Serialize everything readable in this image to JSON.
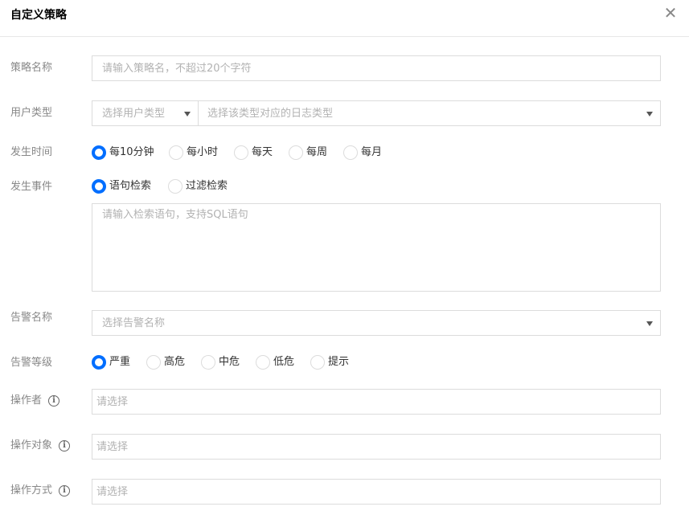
{
  "dialog": {
    "title": "自定义策略"
  },
  "icons": {
    "close": "close-icon",
    "info": "info-icon",
    "dropdown": "caret-down-icon"
  },
  "colors": {
    "accent": "#006eff"
  },
  "fields": {
    "policy_name": {
      "label": "策略名称",
      "placeholder": "请输入策略名，不超过20个字符"
    },
    "user_type": {
      "label": "用户类型",
      "user_placeholder": "选择用户类型",
      "log_placeholder": "选择该类型对应的日志类型"
    },
    "occur_time": {
      "label": "发生时间",
      "options": [
        "每10分钟",
        "每小时",
        "每天",
        "每周",
        "每月"
      ],
      "selected": "每10分钟"
    },
    "occur_event": {
      "label": "发生事件",
      "options": [
        "语句检索",
        "过滤检索"
      ],
      "selected": "语句检索",
      "textarea_placeholder": "请输入检索语句，支持SQL语句"
    },
    "alert_name": {
      "label": "告警名称",
      "placeholder": "选择告警名称"
    },
    "alert_level": {
      "label": "告警等级",
      "options": [
        "严重",
        "高危",
        "中危",
        "低危",
        "提示"
      ],
      "selected": "严重"
    },
    "operator": {
      "label": "操作者",
      "placeholder": "请选择"
    },
    "op_object": {
      "label": "操作对象",
      "placeholder": "请选择"
    },
    "op_method": {
      "label": "操作方式",
      "placeholder": "请选择"
    }
  }
}
